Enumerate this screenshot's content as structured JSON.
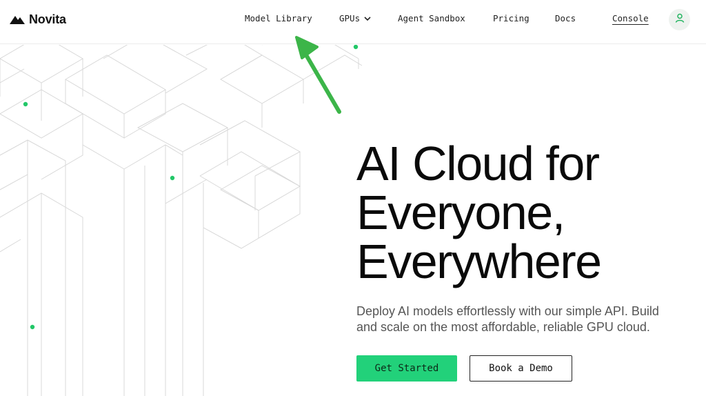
{
  "header": {
    "logo_text": "Novita",
    "nav": {
      "model_library": "Model Library",
      "gpus": "GPUs",
      "agent_sandbox": "Agent Sandbox",
      "pricing": "Pricing",
      "docs": "Docs",
      "console": "Console"
    },
    "icons": {
      "logo": "novita-logo-icon",
      "gpus_dropdown": "chevron-down-icon",
      "avatar": "user-icon"
    }
  },
  "hero": {
    "title_line1": "AI Cloud for",
    "title_line2": "Everyone,",
    "title_line3": "Everywhere",
    "subtitle": "Deploy AI models effortlessly with our simple API. Build and scale on the most affordable, reliable GPU cloud.",
    "primary_button": "Get Started",
    "secondary_button": "Book a Demo"
  },
  "colors": {
    "accent_green": "#22d17a",
    "highlight_green": "#3cb549",
    "pattern_line": "#d6d6d6"
  }
}
